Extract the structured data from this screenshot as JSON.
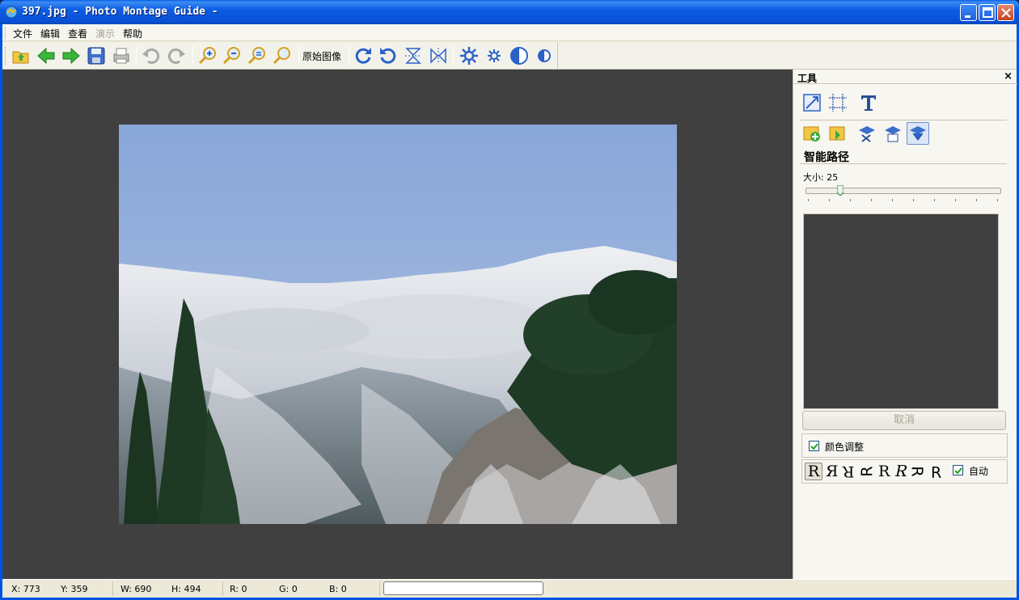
{
  "window": {
    "title": "397.jpg - Photo Montage Guide -"
  },
  "menu": {
    "items": [
      {
        "label": "文件",
        "disabled": false
      },
      {
        "label": "编辑",
        "disabled": false
      },
      {
        "label": "查看",
        "disabled": false
      },
      {
        "label": "演示",
        "disabled": true
      },
      {
        "label": "帮助",
        "disabled": false
      }
    ]
  },
  "toolbar": {
    "icons": [
      "open-folder-icon",
      "back-arrow-icon",
      "forward-arrow-icon",
      "save-icon",
      "print-icon",
      "undo-icon",
      "redo-icon",
      "zoom-in-icon",
      "zoom-out-icon",
      "zoom-fit-icon",
      "zoom-actual-icon",
      "rotate-cw-icon",
      "rotate-ccw-icon",
      "flip-vertical-icon",
      "flip-horizontal-icon",
      "brightness-up-icon",
      "brightness-down-icon",
      "contrast-up-icon",
      "contrast-down-icon"
    ],
    "original_label": "原始图像"
  },
  "panel": {
    "title": "工具",
    "section_title": "智能路径",
    "size_label": "大小: 25",
    "size_value": 25,
    "cancel_label": "取消",
    "color_adjust_label": "颜色调整",
    "color_adjust_checked": true,
    "auto_label": "自动",
    "auto_checked": true,
    "glyphs": [
      "R",
      "Я",
      "R",
      "ꓤ",
      "R",
      "Я",
      "ꓤ",
      "ꓤ"
    ]
  },
  "status": {
    "x": "X: 773",
    "y": "Y: 359",
    "w": "W: 690",
    "h": "H: 494",
    "r": "R: 0",
    "g": "G: 0",
    "b": "B: 0"
  }
}
